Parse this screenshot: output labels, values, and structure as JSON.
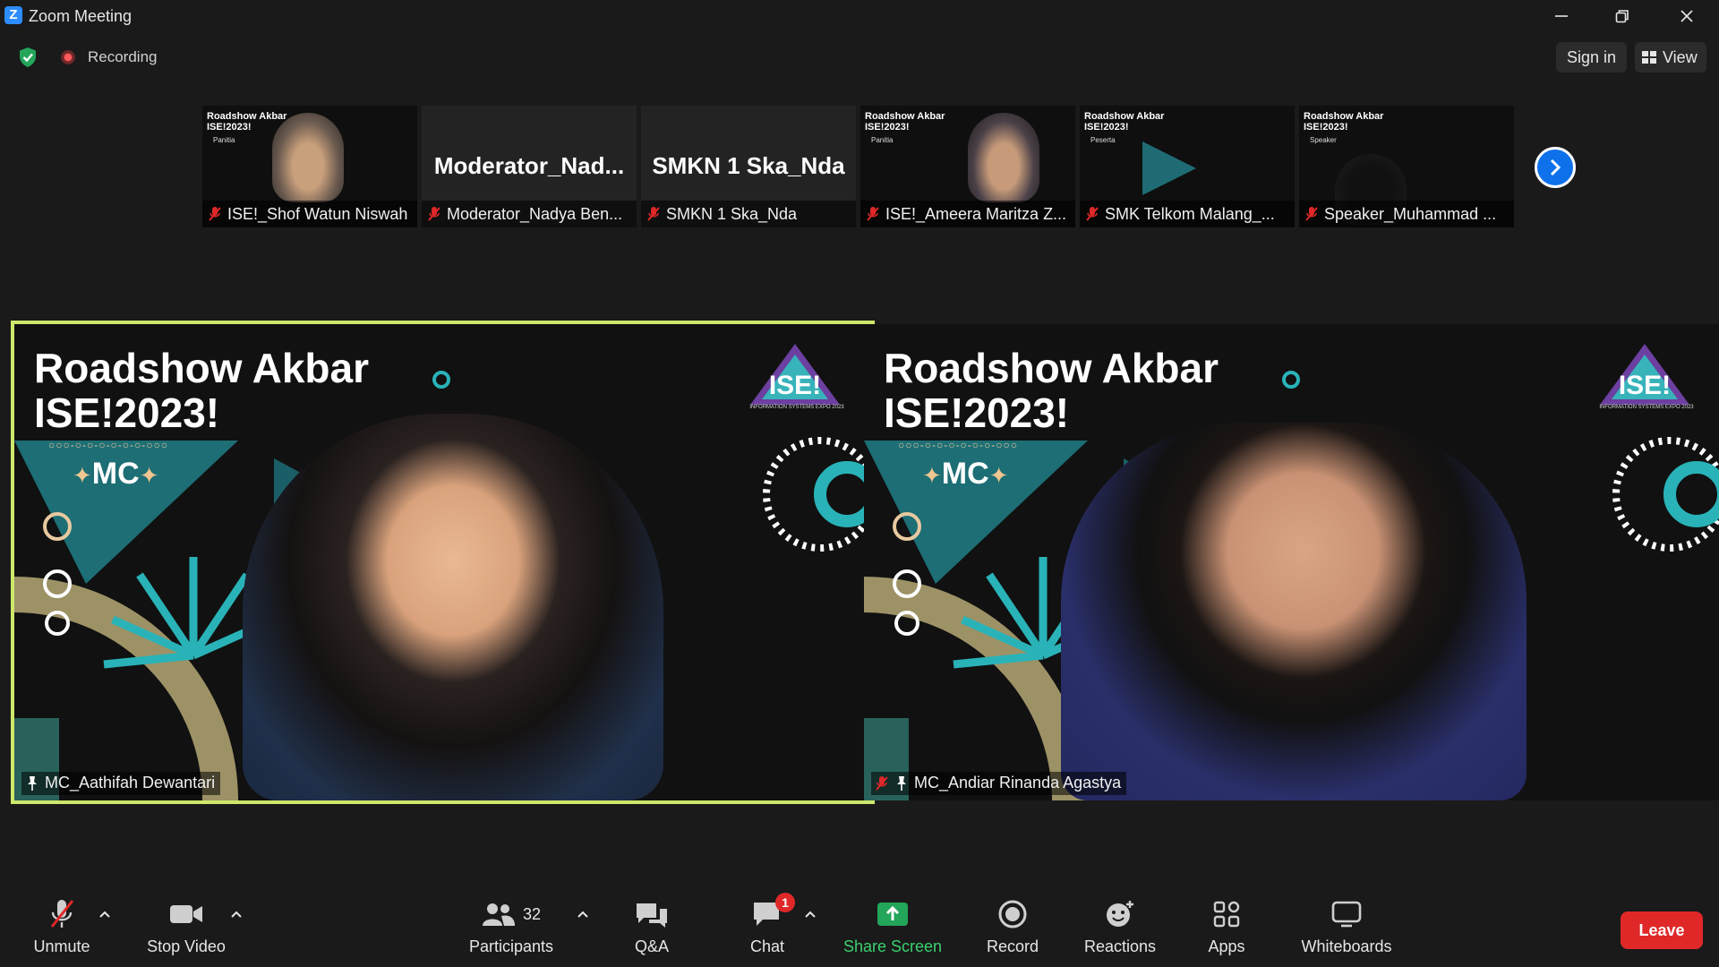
{
  "window": {
    "title": "Zoom Meeting"
  },
  "status": {
    "recording_label": "Recording",
    "sign_in": "Sign in",
    "view": "View"
  },
  "thumbnails": [
    {
      "name": "ISE!_Shof Watun Niswah",
      "type": "video",
      "mini_title": "Roadshow Akbar ISE!2023!",
      "mini_tag": "Panitia"
    },
    {
      "name": "Moderator_Nadya Ben...",
      "type": "name",
      "display_name": "Moderator_Nad..."
    },
    {
      "name": "SMKN 1 Ska_Nda",
      "type": "name",
      "display_name": "SMKN 1 Ska_Nda"
    },
    {
      "name": "ISE!_Ameera Maritza Z...",
      "type": "video",
      "mini_title": "Roadshow Akbar ISE!2023!",
      "mini_tag": "Panitia"
    },
    {
      "name": "SMK Telkom Malang_...",
      "type": "video",
      "mini_title": "Roadshow Akbar ISE!2023!",
      "mini_tag": "Peserta"
    },
    {
      "name": "Speaker_Muhammad ...",
      "type": "video",
      "mini_title": "Roadshow Akbar ISE!2023!",
      "mini_tag": "Speaker"
    }
  ],
  "main_tiles": [
    {
      "name": "MC_Aathifah Dewantari",
      "headline_1": "Roadshow Akbar",
      "headline_2": "ISE!2023!",
      "role": "MC",
      "logo_text": "ISE!",
      "logo_sub": "INFORMATION SYSTEMS EXPO 2023",
      "active_speaker": true
    },
    {
      "name": "MC_Andiar Rinanda Agastya",
      "headline_1": "Roadshow Akbar",
      "headline_2": "ISE!2023!",
      "role": "MC",
      "logo_text": "ISE!",
      "logo_sub": "INFORMATION SYSTEMS EXPO 2023",
      "active_speaker": false
    }
  ],
  "toolbar": {
    "unmute": "Unmute",
    "stop_video": "Stop Video",
    "participants": "Participants",
    "participants_count": "32",
    "qa": "Q&A",
    "chat": "Chat",
    "chat_badge": "1",
    "share_screen": "Share Screen",
    "record": "Record",
    "reactions": "Reactions",
    "apps": "Apps",
    "whiteboards": "Whiteboards",
    "leave": "Leave"
  },
  "colors": {
    "accent_blue": "#0e71eb",
    "active_speaker_border": "#cde86a",
    "leave_red": "#e02828",
    "share_green": "#3ad16e"
  }
}
